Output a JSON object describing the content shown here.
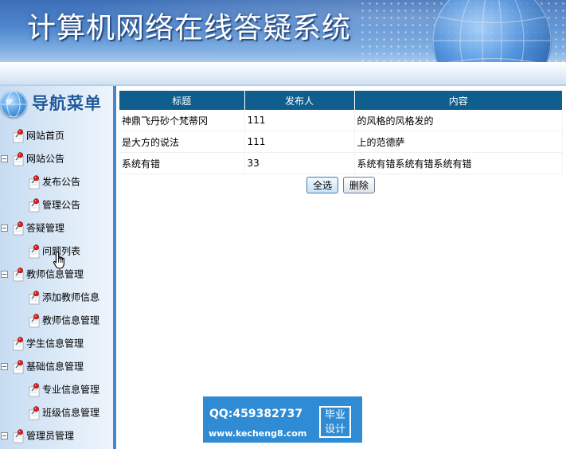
{
  "header": {
    "site_title": "计算机网络在线答疑系统"
  },
  "sidebar": {
    "title": "导航菜单",
    "items": [
      {
        "label": "网站首页",
        "level": 0,
        "collapsible": false
      },
      {
        "label": "网站公告",
        "level": 0,
        "collapsible": true
      },
      {
        "label": "发布公告",
        "level": 1,
        "collapsible": false
      },
      {
        "label": "管理公告",
        "level": 1,
        "collapsible": false
      },
      {
        "label": "答疑管理",
        "level": 0,
        "collapsible": true
      },
      {
        "label": "问题列表",
        "level": 1,
        "collapsible": false
      },
      {
        "label": "教师信息管理",
        "level": 0,
        "collapsible": true
      },
      {
        "label": "添加教师信息",
        "level": 1,
        "collapsible": false
      },
      {
        "label": "教师信息管理",
        "level": 1,
        "collapsible": false
      },
      {
        "label": "学生信息管理",
        "level": 0,
        "collapsible": false
      },
      {
        "label": "基础信息管理",
        "level": 0,
        "collapsible": true
      },
      {
        "label": "专业信息管理",
        "level": 1,
        "collapsible": false
      },
      {
        "label": "班级信息管理",
        "level": 1,
        "collapsible": false
      },
      {
        "label": "管理员管理",
        "level": 0,
        "collapsible": true
      }
    ]
  },
  "table": {
    "columns": [
      "标题",
      "发布人",
      "内容"
    ],
    "rows": [
      [
        "神鼎飞丹砂个梵蒂冈",
        "111",
        "的风格的风格发的"
      ],
      [
        "是大方的说法",
        "111",
        "上的范德萨"
      ],
      [
        "系统有错",
        "33",
        "系统有错系统有错系统有错"
      ]
    ]
  },
  "actions": {
    "select_all_label": "全选",
    "delete_label": "删除"
  },
  "watermark": {
    "qq": "QQ:459382737",
    "url": "www.kecheng8.com",
    "badge": "毕业设计"
  },
  "colors": {
    "table_header": "#0f5e8e",
    "sidebar_border": "#4a86c8",
    "banner": "#4f88cf",
    "watermark": "#2f8bd3"
  },
  "icons": {
    "nav_item": "pushpin-icon",
    "nav_header": "globe-icon",
    "cursor": "hand-pointer-icon"
  }
}
